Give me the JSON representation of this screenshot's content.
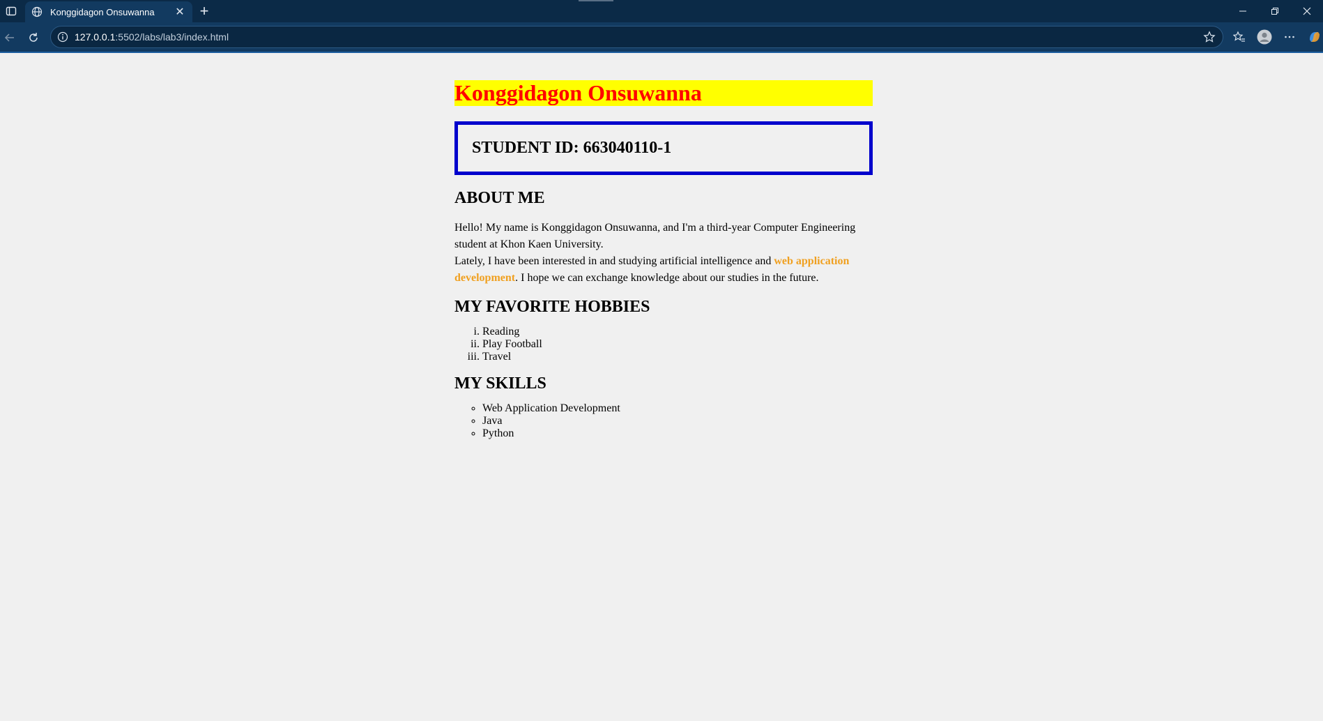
{
  "browser": {
    "tab_title": "Konggidagon Onsuwanna",
    "url_host": "127.0.0.1",
    "url_rest": ":5502/labs/lab3/index.html",
    "icons": {
      "tab_actions": "tab-actions-icon",
      "globe": "globe-icon",
      "close": "close-icon",
      "new_tab": "plus-icon",
      "back": "back-arrow-icon",
      "reload": "reload-icon",
      "info": "info-icon",
      "favorite": "star-icon",
      "favorites": "favorites-icon",
      "profile": "profile-icon",
      "more": "more-icon",
      "copilot": "copilot-icon"
    }
  },
  "page": {
    "name": "Konggidagon Onsuwanna",
    "student_id": "STUDENT ID: 663040110-1",
    "about": {
      "title": "ABOUT ME",
      "line1": "Hello! My name is Konggidagon Onsuwanna, and I'm a third-year Computer Engineering student at Khon Kaen University.",
      "line2_before": "Lately, I have been interested in and studying artificial intelligence and ",
      "line2_highlight": "web application development",
      "line2_after": ". I hope we can exchange knowledge about our studies in the future."
    },
    "hobbies": {
      "title": "MY FAVORITE HOBBIES",
      "items": [
        "Reading",
        "Play Football",
        "Travel"
      ]
    },
    "skills": {
      "title": "MY SKILLS",
      "items": [
        "Web Application Development",
        "Java",
        "Python"
      ]
    }
  },
  "colors": {
    "name_background": "#ffff00",
    "name_text": "#ff0000",
    "id_border": "#0000cc",
    "highlight": "#f0a020",
    "page_background": "#f0f0f0",
    "chrome_titlebar": "#0b2a47",
    "chrome_toolbar": "#123a60"
  }
}
